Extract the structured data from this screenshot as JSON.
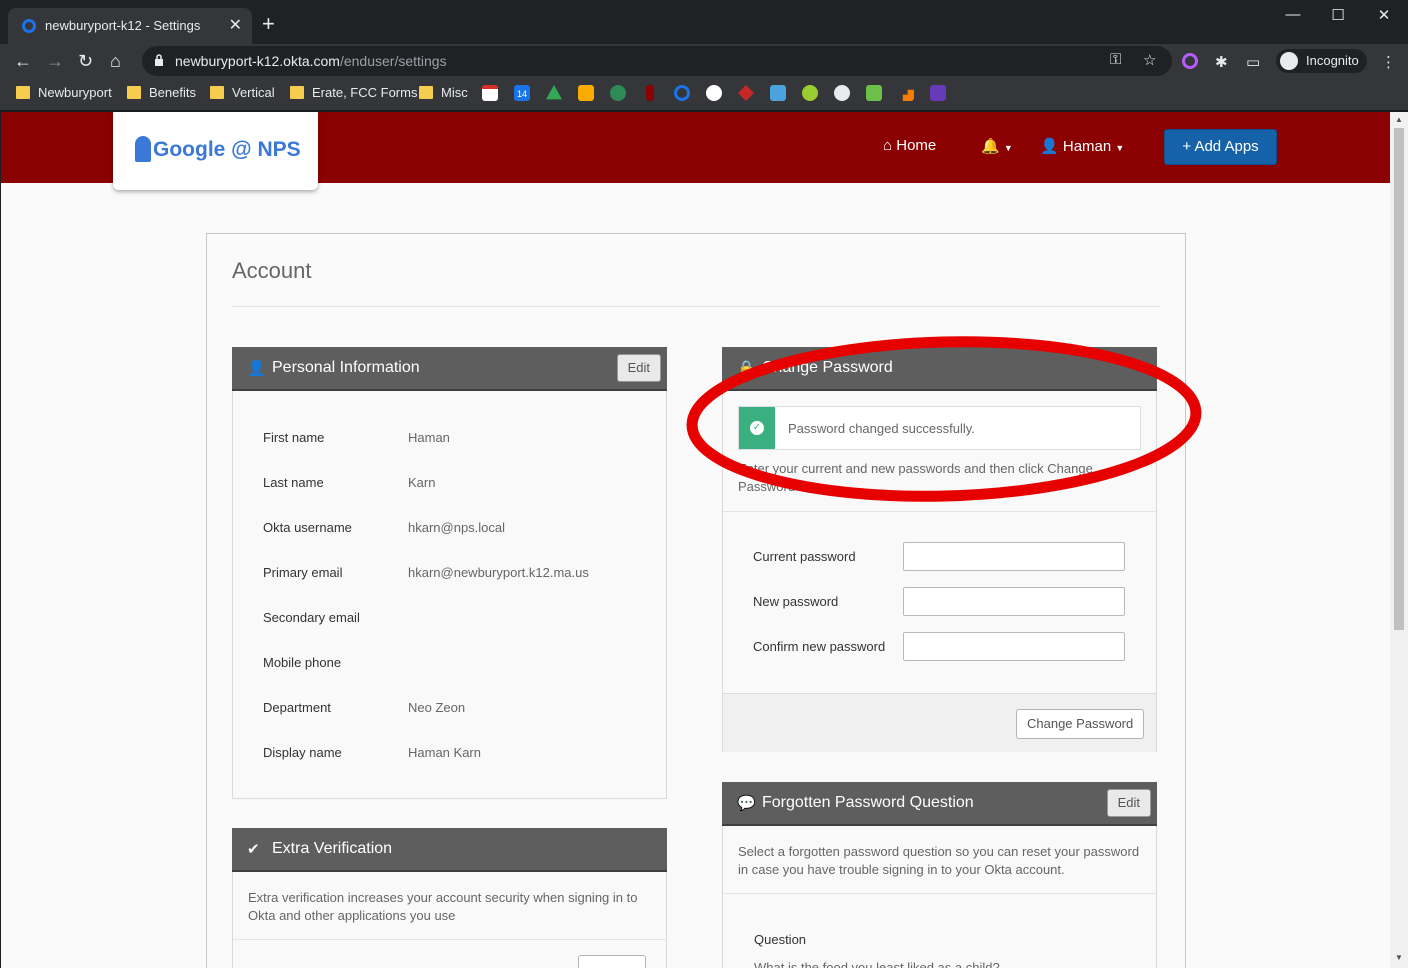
{
  "browser": {
    "tab_title": "newburyport-k12 - Settings",
    "url_host": "newburyport-k12.okta.com",
    "url_path": "/enduser/settings",
    "profile_label": "Incognito",
    "bookmarks": [
      "Newburyport",
      "Benefits",
      "Vertical",
      "Erate, FCC Forms",
      "Misc"
    ],
    "calendar_badge": "14"
  },
  "header": {
    "logo_text": "Google @ NPS",
    "nav_home": "Home",
    "nav_user": "Haman",
    "add_apps": "Add Apps"
  },
  "account": {
    "title": "Account"
  },
  "personal_info": {
    "title": "Personal Information",
    "edit": "Edit",
    "rows": [
      {
        "label": "First name",
        "value": "Haman"
      },
      {
        "label": "Last name",
        "value": "Karn"
      },
      {
        "label": "Okta username",
        "value": "hkarn@nps.local"
      },
      {
        "label": "Primary email",
        "value": "hkarn@newburyport.k12.ma.us"
      },
      {
        "label": "Secondary email",
        "value": ""
      },
      {
        "label": "Mobile phone",
        "value": ""
      },
      {
        "label": "Department",
        "value": "Neo Zeon"
      },
      {
        "label": "Display name",
        "value": "Haman Karn"
      }
    ]
  },
  "change_password": {
    "title": "Change Password",
    "alert": "Password changed successfully.",
    "description": "Enter your current and new passwords and then click Change Password",
    "current_label": "Current password",
    "new_label": "New password",
    "confirm_label": "Confirm new password",
    "button": "Change Password"
  },
  "forgotten_question": {
    "title": "Forgotten Password Question",
    "edit": "Edit",
    "description": "Select a forgotten password question so you can reset your password in case you have trouble signing in to your Okta account.",
    "question_label": "Question",
    "question_value": "What is the food you least liked as a child?"
  },
  "extra_verification": {
    "title": "Extra Verification",
    "description": "Extra verification increases your account security when signing in to Okta and other applications you use"
  },
  "colors": {
    "header_bg": "#8b0000",
    "add_apps_bg": "#1662a8",
    "success": "#3ab080",
    "annotation": "#e60000"
  }
}
